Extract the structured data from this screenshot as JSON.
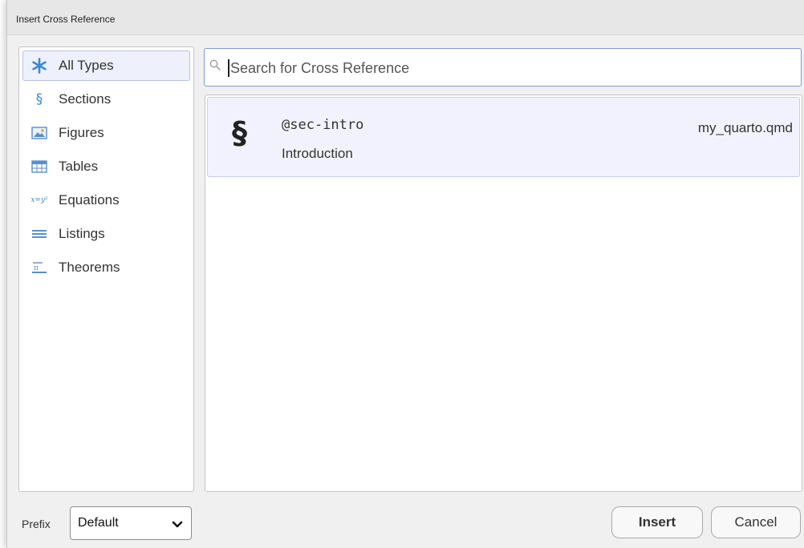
{
  "window": {
    "title": "Insert Cross Reference"
  },
  "types": [
    {
      "label": "All Types",
      "icon": "asterisk-icon",
      "selected": true
    },
    {
      "label": "Sections",
      "icon": "section-icon",
      "selected": false
    },
    {
      "label": "Figures",
      "icon": "image-icon",
      "selected": false
    },
    {
      "label": "Tables",
      "icon": "table-icon",
      "selected": false
    },
    {
      "label": "Equations",
      "icon": "equation-icon",
      "selected": false
    },
    {
      "label": "Listings",
      "icon": "listing-icon",
      "selected": false
    },
    {
      "label": "Theorems",
      "icon": "theorem-icon",
      "selected": false
    }
  ],
  "search": {
    "placeholder": "Search for Cross Reference",
    "value": ""
  },
  "results": [
    {
      "symbol": "§",
      "id": "@sec-intro",
      "title": "Introduction",
      "file": "my_quarto.qmd"
    }
  ],
  "footer": {
    "prefix_label": "Prefix",
    "prefix_value": "Default",
    "insert_label": "Insert",
    "cancel_label": "Cancel"
  },
  "colors": {
    "accent": "#3a7bd5",
    "selected_bg": "#eef0fb",
    "selected_border": "#b9c2ea"
  }
}
